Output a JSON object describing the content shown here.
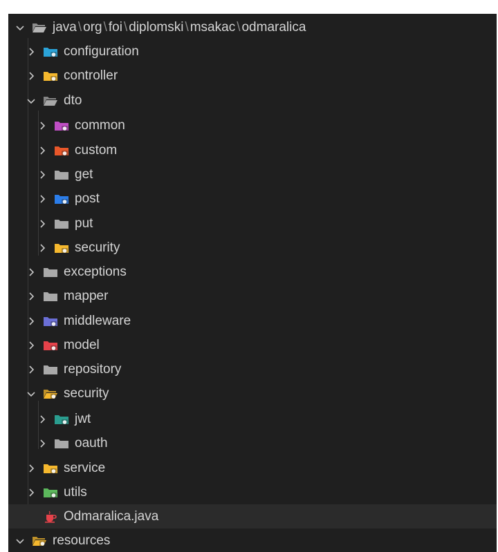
{
  "explorer": {
    "root": {
      "path_segments": [
        "java",
        "org",
        "foi",
        "diplomski",
        "msakac",
        "odmaralica"
      ],
      "path_separator": "\\"
    },
    "items": [
      {
        "label": "configuration",
        "expanded": false,
        "icon": "folder-config-icon",
        "color": "#2ba3d8"
      },
      {
        "label": "controller",
        "expanded": false,
        "icon": "folder-controller-icon",
        "color": "#f5b82e"
      },
      {
        "label": "dto",
        "expanded": true,
        "icon": "folder-open-icon",
        "color": "#a9a9a9"
      },
      {
        "label": "common",
        "expanded": false,
        "icon": "folder-common-icon",
        "color": "#c04ec5"
      },
      {
        "label": "custom",
        "expanded": false,
        "icon": "folder-custom-icon",
        "color": "#e8572a"
      },
      {
        "label": "get",
        "expanded": false,
        "icon": "folder-icon",
        "color": "#a9a9a9"
      },
      {
        "label": "post",
        "expanded": false,
        "icon": "folder-post-icon",
        "color": "#2b7de9"
      },
      {
        "label": "put",
        "expanded": false,
        "icon": "folder-icon",
        "color": "#a9a9a9"
      },
      {
        "label": "security",
        "expanded": false,
        "icon": "folder-security-icon",
        "color": "#f5b82e"
      },
      {
        "label": "exceptions",
        "expanded": false,
        "icon": "folder-icon",
        "color": "#a9a9a9"
      },
      {
        "label": "mapper",
        "expanded": false,
        "icon": "folder-icon",
        "color": "#a9a9a9"
      },
      {
        "label": "middleware",
        "expanded": false,
        "icon": "folder-middleware-icon",
        "color": "#6b6fd6"
      },
      {
        "label": "model",
        "expanded": false,
        "icon": "folder-model-icon",
        "color": "#e5424a"
      },
      {
        "label": "repository",
        "expanded": false,
        "icon": "folder-icon",
        "color": "#a9a9a9"
      },
      {
        "label": "security",
        "expanded": true,
        "icon": "folder-security-open-icon",
        "color": "#f5b82e"
      },
      {
        "label": "jwt",
        "expanded": false,
        "icon": "folder-jwt-icon",
        "color": "#2a9d8f"
      },
      {
        "label": "oauth",
        "expanded": false,
        "icon": "folder-icon",
        "color": "#a9a9a9"
      },
      {
        "label": "service",
        "expanded": false,
        "icon": "folder-service-icon",
        "color": "#f5b82e"
      },
      {
        "label": "utils",
        "expanded": false,
        "icon": "folder-utils-icon",
        "color": "#5cb85c"
      },
      {
        "label": "Odmaralica.java",
        "expanded": null,
        "icon": "java-file-icon",
        "color": "#e5424a"
      },
      {
        "label": "resources",
        "expanded": true,
        "icon": "folder-resources-open-icon",
        "color": "#f5b82e"
      }
    ]
  }
}
